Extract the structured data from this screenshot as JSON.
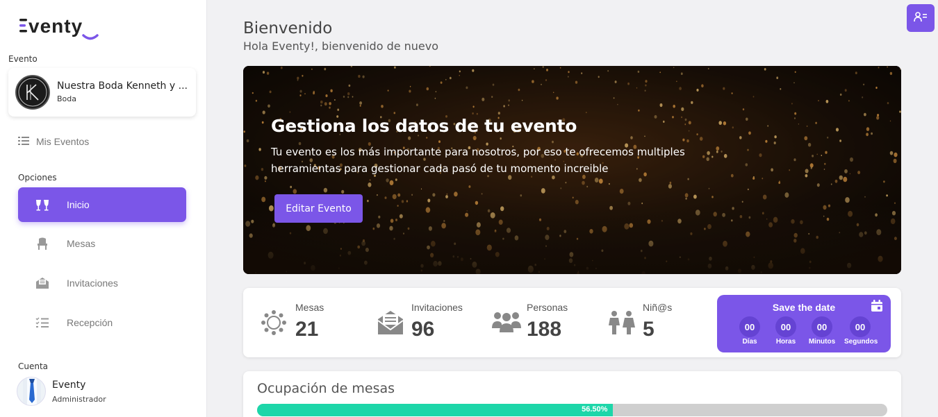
{
  "app": {
    "logo_text": "Eventy",
    "accent_color": "#7b56e8"
  },
  "sidebar": {
    "event_section_label": "Evento",
    "event": {
      "name": "Nuestra Boda Kenneth y ...",
      "type": "Boda"
    },
    "my_events_label": "Mis Eventos",
    "options_label": "Opciones",
    "items": [
      {
        "label": "Inicio",
        "icon": "glasses-cheers-icon",
        "active": true
      },
      {
        "label": "Mesas",
        "icon": "chair-icon",
        "active": false
      },
      {
        "label": "Invitaciones",
        "icon": "envelope-open-icon",
        "active": false
      },
      {
        "label": "Recepción",
        "icon": "checklist-icon",
        "active": false
      }
    ],
    "account_label": "Cuenta",
    "account": {
      "name": "Eventy",
      "role": "Administrador"
    }
  },
  "header": {
    "title": "Bienvenido",
    "subtitle": "Hola Eventy!, bienvenido de nuevo"
  },
  "hero": {
    "title": "Gestiona los datos de tu evento",
    "text": "Tu evento es los más importante para nosotros, por eso te ofrecemos multiples herramientas para gestionar cada pasó de tu momento increible",
    "button_label": "Editar Evento"
  },
  "stats": [
    {
      "label": "Mesas",
      "value": "21",
      "icon": "round-table-icon"
    },
    {
      "label": "Invitaciones",
      "value": "96",
      "icon": "envelope-icon"
    },
    {
      "label": "Personas",
      "value": "188",
      "icon": "people-icon"
    },
    {
      "label": "Niñ@s",
      "value": "5",
      "icon": "children-icon"
    }
  ],
  "save_the_date": {
    "title": "Save the date",
    "days": "00",
    "days_label": "Días",
    "hours": "00",
    "hours_label": "Horas",
    "minutes": "00",
    "minutes_label": "Minutos",
    "seconds": "00",
    "seconds_label": "Segundos"
  },
  "occupancy": {
    "title": "Ocupación de mesas",
    "percent": 56.5,
    "percent_label": "56.50%"
  }
}
